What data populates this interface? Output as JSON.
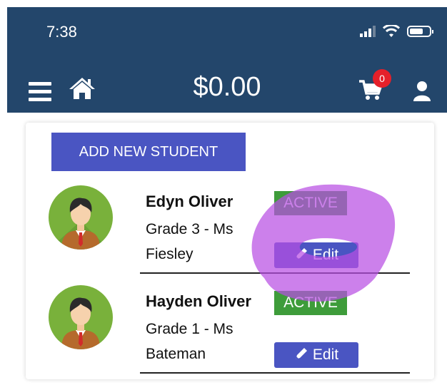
{
  "status_bar": {
    "time": "7:38"
  },
  "header": {
    "balance": "$0.00",
    "cart_count": "0"
  },
  "actions": {
    "add_student": "ADD NEW STUDENT"
  },
  "students": [
    {
      "name": "Edyn Oliver",
      "grade_line1": "Grade 3 - Ms",
      "grade_line2": "Fiesley",
      "status": "ACTIVE",
      "edit_label": "Edit"
    },
    {
      "name": "Hayden Oliver",
      "grade_line1": "Grade 1 - Ms",
      "grade_line2": "Bateman",
      "status": "ACTIVE",
      "edit_label": "Edit"
    }
  ],
  "colors": {
    "header_bg": "#23466b",
    "primary_button": "#4a55c2",
    "active_badge": "#3e9c3a",
    "cart_badge": "#e5202a",
    "avatar_bg": "#79b13b",
    "scribble": "#b94fe3"
  },
  "icons": [
    "menu-icon",
    "home-icon",
    "cart-icon",
    "user-icon",
    "pencil-icon",
    "wifi-icon",
    "signal-icon",
    "battery-icon"
  ]
}
